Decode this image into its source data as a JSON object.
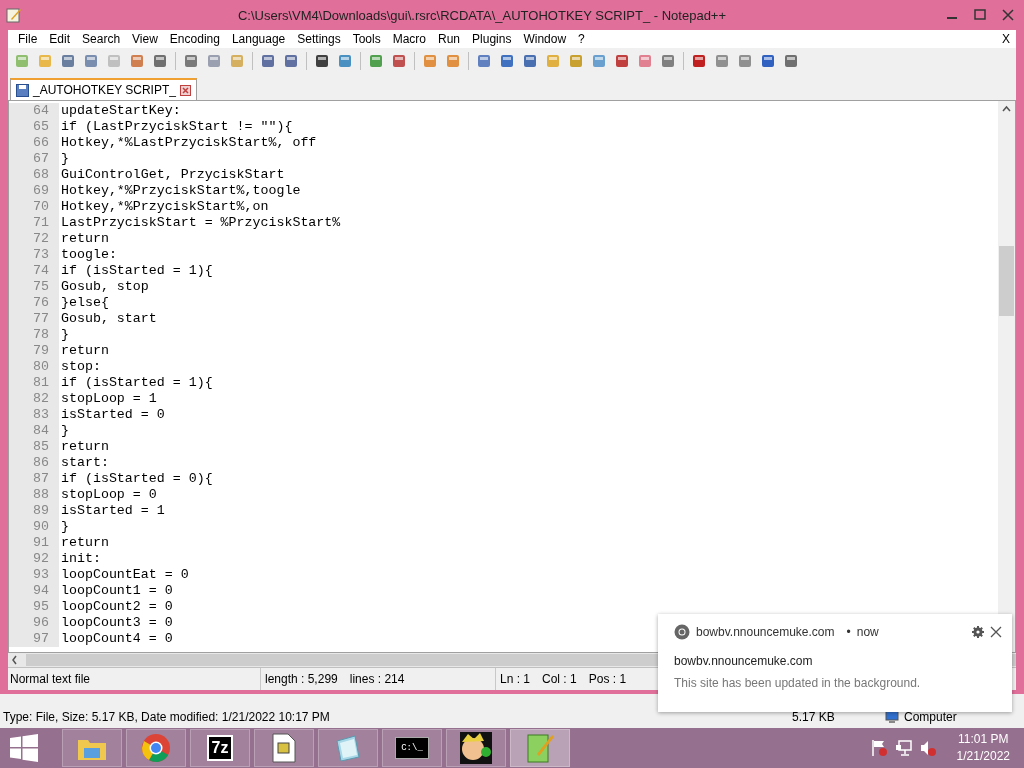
{
  "window": {
    "title": "C:\\Users\\VM4\\Downloads\\gui\\.rsrc\\RCDATA\\_AUTOHOTKEY SCRIPT_ - Notepad++"
  },
  "menu": [
    "File",
    "Edit",
    "Search",
    "View",
    "Encoding",
    "Language",
    "Settings",
    "Tools",
    "Macro",
    "Run",
    "Plugins",
    "Window",
    "?"
  ],
  "menu_close": "X",
  "tabs": [
    {
      "label": "_AUTOHOTKEY SCRIPT_",
      "selected": true
    }
  ],
  "editor": {
    "lines": [
      {
        "number": "64",
        "text": "updateStartKey:"
      },
      {
        "number": "65",
        "text": "if (LastPrzyciskStart != \"\"){"
      },
      {
        "number": "66",
        "text": "Hotkey,*%LastPrzyciskStart%, off"
      },
      {
        "number": "67",
        "text": "}"
      },
      {
        "number": "68",
        "text": "GuiControlGet, PrzyciskStart"
      },
      {
        "number": "69",
        "text": "Hotkey,*%PrzyciskStart%,toogle"
      },
      {
        "number": "70",
        "text": "Hotkey,*%PrzyciskStart%,on"
      },
      {
        "number": "71",
        "text": "LastPrzyciskStart = %PrzyciskStart%"
      },
      {
        "number": "72",
        "text": "return"
      },
      {
        "number": "73",
        "text": "toogle:"
      },
      {
        "number": "74",
        "text": "if (isStarted = 1){"
      },
      {
        "number": "75",
        "text": "Gosub, stop"
      },
      {
        "number": "76",
        "text": "}else{"
      },
      {
        "number": "77",
        "text": "Gosub, start"
      },
      {
        "number": "78",
        "text": "}"
      },
      {
        "number": "79",
        "text": "return"
      },
      {
        "number": "80",
        "text": "stop:"
      },
      {
        "number": "81",
        "text": "if (isStarted = 1){"
      },
      {
        "number": "82",
        "text": "stopLoop = 1"
      },
      {
        "number": "83",
        "text": "isStarted = 0"
      },
      {
        "number": "84",
        "text": "}"
      },
      {
        "number": "85",
        "text": "return"
      },
      {
        "number": "86",
        "text": "start:"
      },
      {
        "number": "87",
        "text": "if (isStarted = 0){"
      },
      {
        "number": "88",
        "text": "stopLoop = 0"
      },
      {
        "number": "89",
        "text": "isStarted = 1"
      },
      {
        "number": "90",
        "text": "}"
      },
      {
        "number": "91",
        "text": "return"
      },
      {
        "number": "92",
        "text": "init:"
      },
      {
        "number": "93",
        "text": "loopCountEat = 0"
      },
      {
        "number": "94",
        "text": "loopCount1 = 0"
      },
      {
        "number": "95",
        "text": "loopCount2 = 0"
      },
      {
        "number": "96",
        "text": "loopCount3 = 0"
      },
      {
        "number": "97",
        "text": "loopCount4 = 0"
      }
    ]
  },
  "status_bar": {
    "file_type": "Normal text file",
    "length": "length : 5,299",
    "lines": "lines : 214",
    "ln": "Ln : 1",
    "col": "Col : 1",
    "pos": "Pos : 1"
  },
  "explorer_status": {
    "details": "Type: File, Size: 5.17 KB, Date modified: 1/21/2022 10:17 PM",
    "size": "5.17 KB",
    "location": "Computer"
  },
  "taskbar": {
    "items": [
      {
        "kind": "folder",
        "active": false
      },
      {
        "kind": "browser",
        "active": false
      },
      {
        "kind": "archiver",
        "label": "7z",
        "active": false
      },
      {
        "kind": "document",
        "active": false
      },
      {
        "kind": "notepad",
        "active": false
      },
      {
        "kind": "console",
        "label": "C:\\_",
        "active": false
      },
      {
        "kind": "cartoon",
        "active": false
      },
      {
        "kind": "editor",
        "active": true
      }
    ],
    "time": "11:01 PM",
    "date": "1/21/2022"
  },
  "notification": {
    "origin": "bowbv.nnouncemuke.com",
    "separator": "•",
    "when": "now",
    "title": "bowbv.nnouncemuke.com",
    "body": "This site has been updated in the background."
  }
}
